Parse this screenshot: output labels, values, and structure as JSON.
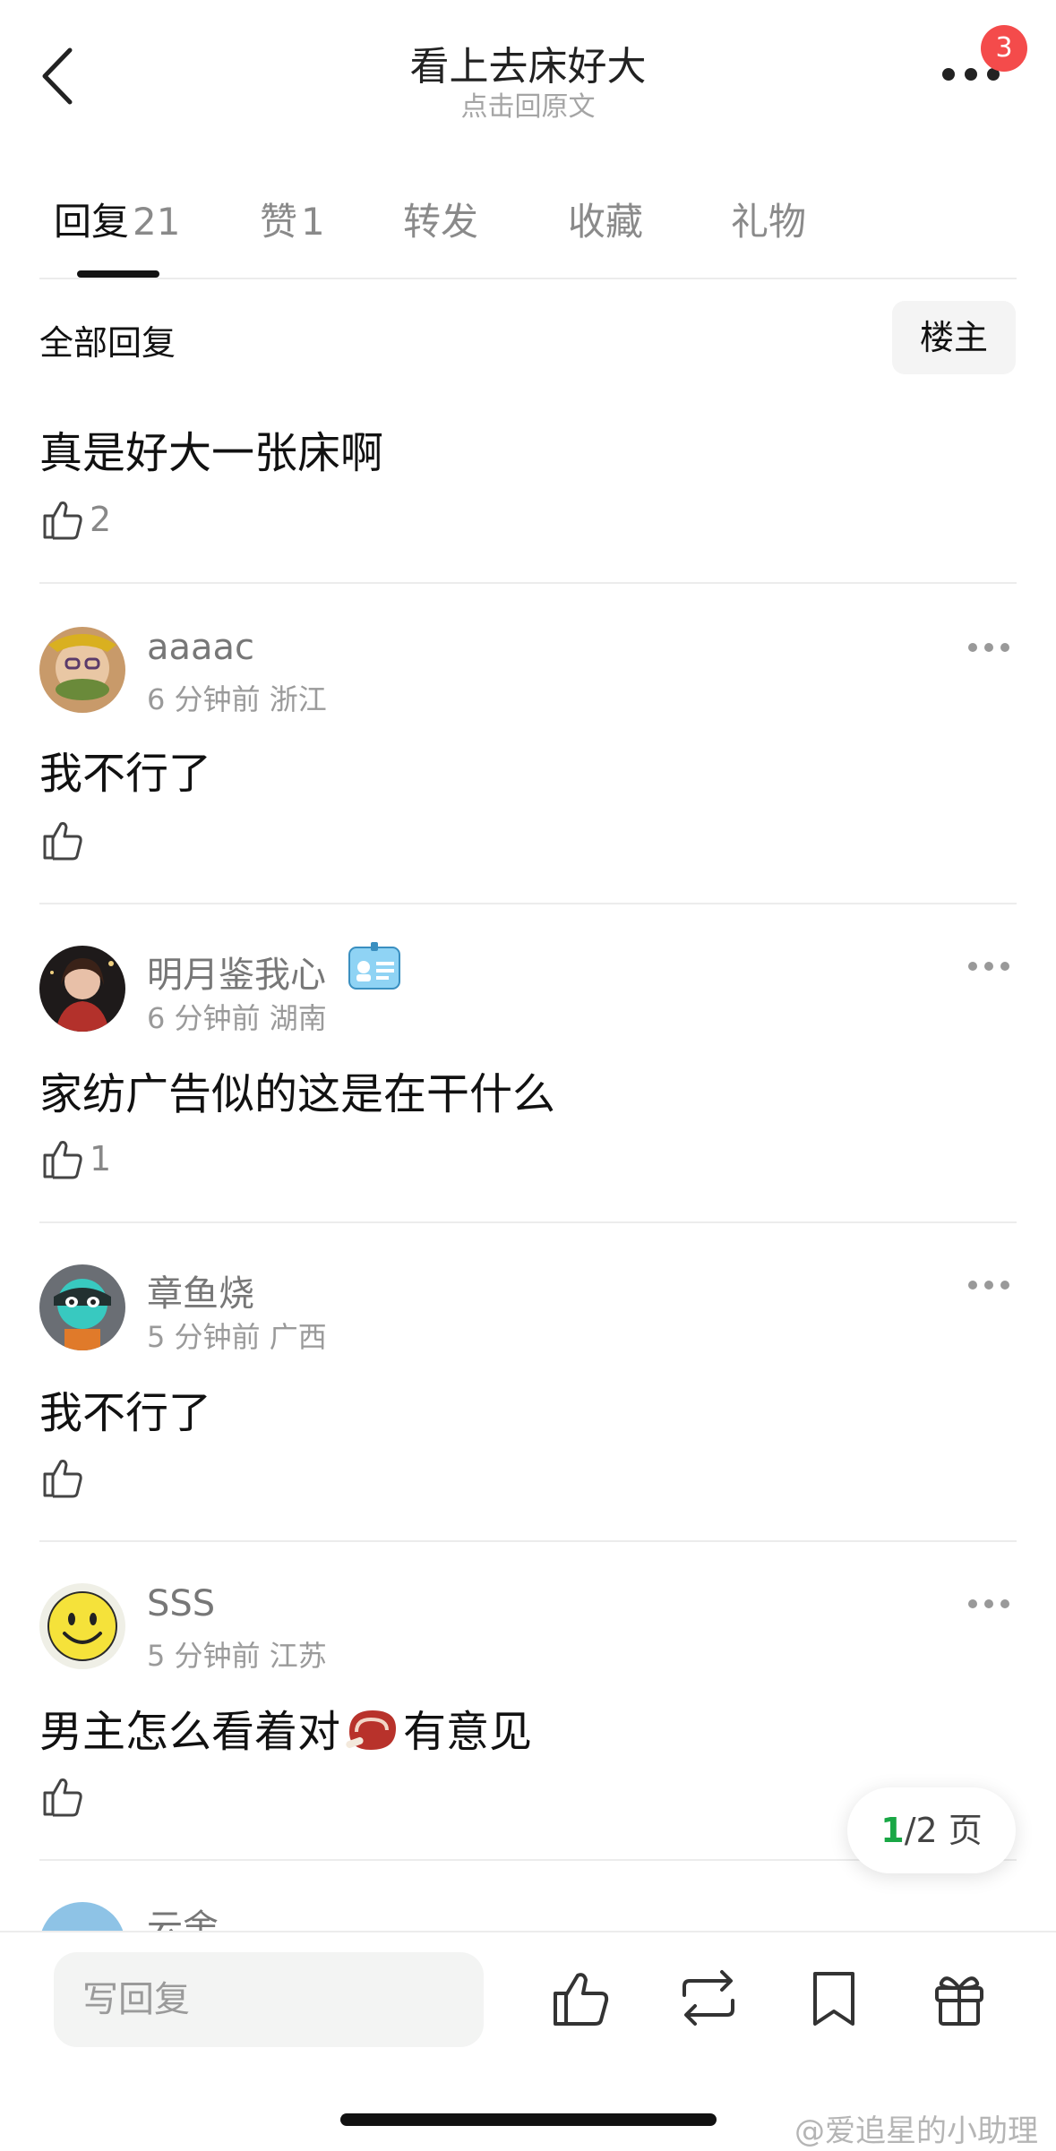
{
  "header": {
    "title": "看上去床好大",
    "subtitle": "点击回原文",
    "notification_count": "3"
  },
  "tabs": [
    {
      "label": "回复",
      "count": "21"
    },
    {
      "label": "赞",
      "count": "1"
    },
    {
      "label": "转发",
      "count": ""
    },
    {
      "label": "收藏",
      "count": ""
    },
    {
      "label": "礼物",
      "count": ""
    }
  ],
  "filter": {
    "label": "全部回复",
    "op_button": "楼主"
  },
  "pinned_comment": {
    "text": "真是好大一张床啊",
    "likes": "2"
  },
  "comments": [
    {
      "username": "aaaac",
      "time": "6 分钟前",
      "location": "浙江",
      "text": "我不行了",
      "likes": ""
    },
    {
      "username": "明月鉴我心",
      "time": "6 分钟前",
      "location": "湖南",
      "text": "家纺广告似的这是在干什么",
      "likes": "1"
    },
    {
      "username": "章鱼烧",
      "time": "5 分钟前",
      "location": "广西",
      "text": "我不行了",
      "likes": ""
    },
    {
      "username": "SSS",
      "time": "5 分钟前",
      "location": "江苏",
      "text_before": "男主怎么看着对",
      "text_after": "有意见",
      "likes": ""
    },
    {
      "username": "云舍"
    }
  ],
  "pagination": {
    "current": "1",
    "total_suffix": "/2 页"
  },
  "bottom_bar": {
    "reply_placeholder": "写回复"
  },
  "watermark": "@爱追星的小助理",
  "icons": [
    "back-icon",
    "more-icon",
    "thumbs-up-icon",
    "repost-icon",
    "bookmark-icon",
    "gift-icon",
    "badge-icon",
    "steak-emoji-icon"
  ]
}
